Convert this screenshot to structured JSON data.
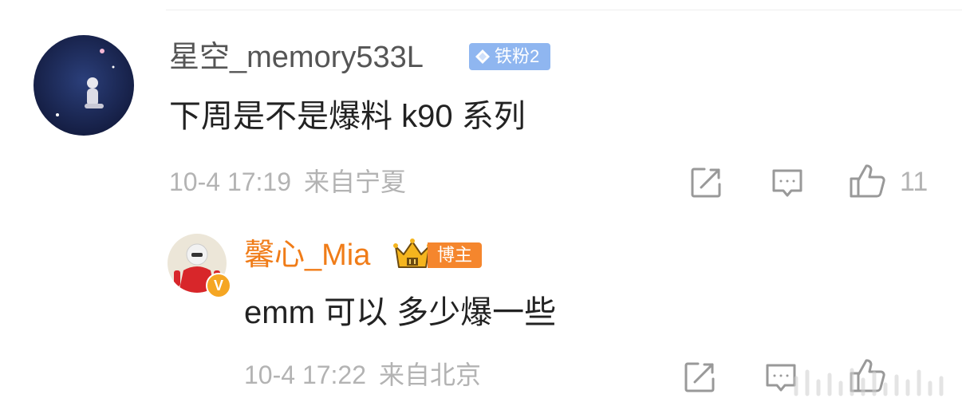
{
  "comment": {
    "username": "星空_memory533L",
    "fan_badge": "铁粉2",
    "text": "下周是不是爆料 k90 系列",
    "date": "10-4 17:19",
    "location": "来自宁夏",
    "like_count": "11"
  },
  "reply": {
    "username": "馨心_Mia",
    "role_badge": "博主",
    "verified_mark": "V",
    "text": "emm 可以 多少爆一些",
    "date": "10-4 17:22",
    "location": "来自北京"
  },
  "icons": [
    "share-icon",
    "reply-icon",
    "like-icon",
    "crown-icon",
    "diamond-icon"
  ],
  "colors": {
    "username": "#555555",
    "blogger_name": "#f07c18",
    "fan_badge": "#8fb6f0",
    "blogger_badge": "#f5862d",
    "meta_text": "#b3b3b3"
  }
}
